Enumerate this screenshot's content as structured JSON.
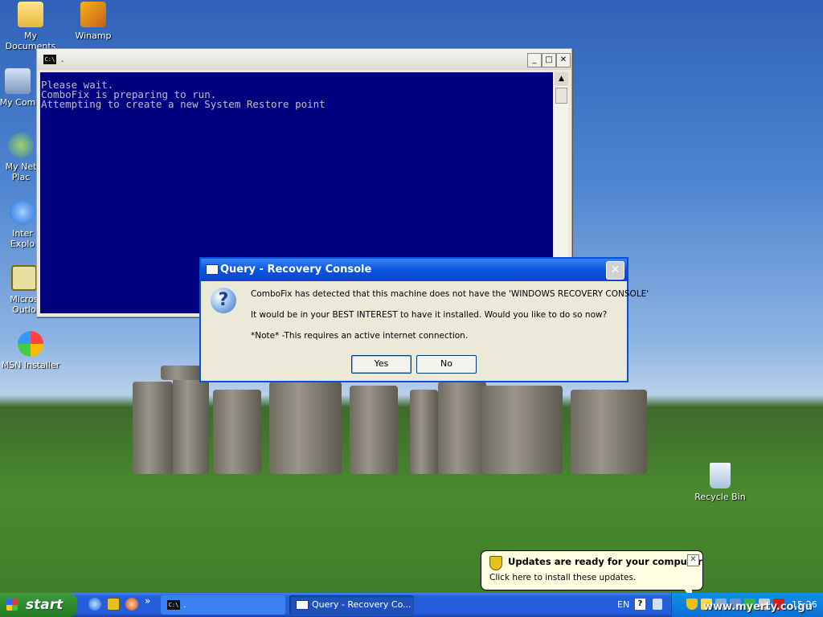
{
  "desktop": {
    "icons": [
      {
        "label": "My Documents",
        "name": "my-documents"
      },
      {
        "label": "Winamp",
        "name": "winamp"
      },
      {
        "label": "My Com",
        "name": "my-computer"
      },
      {
        "label": "My Net\nPlac",
        "name": "my-network-places"
      },
      {
        "label": "Inter\nExplo",
        "name": "internet-explorer"
      },
      {
        "label": "Micros\nOutlo",
        "name": "microsoft-outlook"
      },
      {
        "label": "MSN Installer",
        "name": "msn-installer"
      },
      {
        "label": "Recycle Bin",
        "name": "recycle-bin"
      }
    ]
  },
  "console": {
    "title": ".",
    "icon_text": "C:\\",
    "lines": [
      "Please wait.",
      "ComboFix is preparing to run.",
      "",
      "Attempting to create a new System Restore point"
    ],
    "min_label": "_",
    "max_label": "□",
    "close_label": "✕"
  },
  "dialog": {
    "title": "Query - Recovery Console",
    "icon_glyph": "?",
    "line1": "ComboFix has detected that this machine does not have the 'WINDOWS RECOVERY CONSOLE'",
    "line2": "It would be in your BEST INTEREST to have it installed. Would you like to do so now?",
    "line3": "*Note* -This requires an active internet connection.",
    "yes_label": "Yes",
    "no_label": "No",
    "close_label": "✕"
  },
  "balloon": {
    "title": "Updates are ready for your computer",
    "text": "Click here to install these updates.",
    "close_label": "✕"
  },
  "taskbar": {
    "start_label": "start",
    "more_label": "»",
    "tasks": [
      {
        "label": "."
      },
      {
        "label": "Query - Recovery Co..."
      }
    ],
    "task1_icon_text": "C:\\",
    "language": "EN",
    "help_glyph": "?",
    "clock": "15:26"
  },
  "watermark": "www.myerty.co.gu"
}
